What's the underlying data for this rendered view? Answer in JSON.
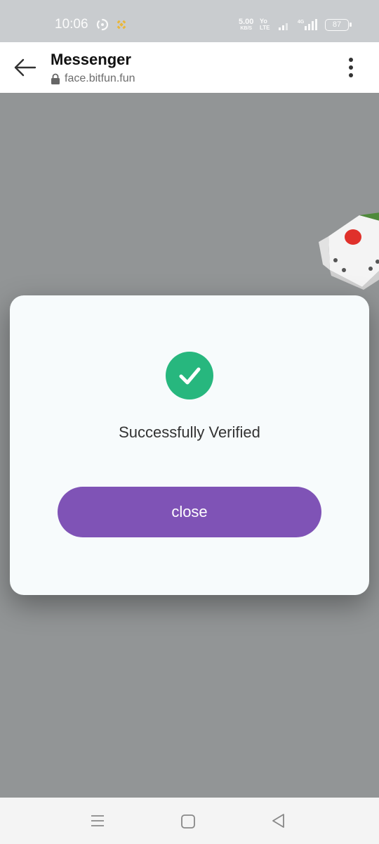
{
  "status_bar": {
    "time": "10:06",
    "speed_value": "5.00",
    "speed_unit": "KB/S",
    "volte_top": "Yo",
    "volte_bottom": "LTE",
    "network_badge": "4G",
    "battery": "87",
    "icons": [
      "sync-icon",
      "binance-icon",
      "signal-icon",
      "signal-4g-icon",
      "battery-icon"
    ]
  },
  "app_bar": {
    "title": "Messenger",
    "url": "face.bitfun.fun",
    "icons": [
      "back-arrow-icon",
      "lock-icon",
      "more-vert-icon"
    ]
  },
  "modal": {
    "message": "Successfully Verified",
    "button_label": "close",
    "icon": "check-circle-icon",
    "colors": {
      "success": "#27b77e",
      "button": "#7f53b6"
    }
  },
  "decor": {
    "icon": "dice-icon"
  },
  "nav_bar": {
    "icons": [
      "recents-menu-icon",
      "home-square-icon",
      "back-triangle-icon"
    ]
  }
}
